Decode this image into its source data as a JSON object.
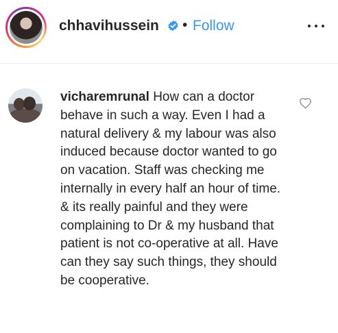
{
  "post_header": {
    "username": "chhavihussein",
    "verified_icon": "verified-badge-icon",
    "separator": "•",
    "follow_label": "Follow",
    "more_icon": "more-options-icon"
  },
  "comment": {
    "username": "vicharemrunal",
    "text": "How can a doctor behave in such a way. Even I had a natural delivery & my labour was also induced because doctor wanted to go on vacation. Staff was checking me internally in every half an hour of time. & its really painful and they were complaining to Dr & my husband that patient is not co-operative at all. Have can they say such things, they should be cooperative.",
    "like_icon": "heart-icon"
  },
  "colors": {
    "link": "#3897f0",
    "text": "#262626",
    "divider": "#efefef",
    "verified": "#3897f0",
    "heart_outline": "#8e8e8e"
  }
}
